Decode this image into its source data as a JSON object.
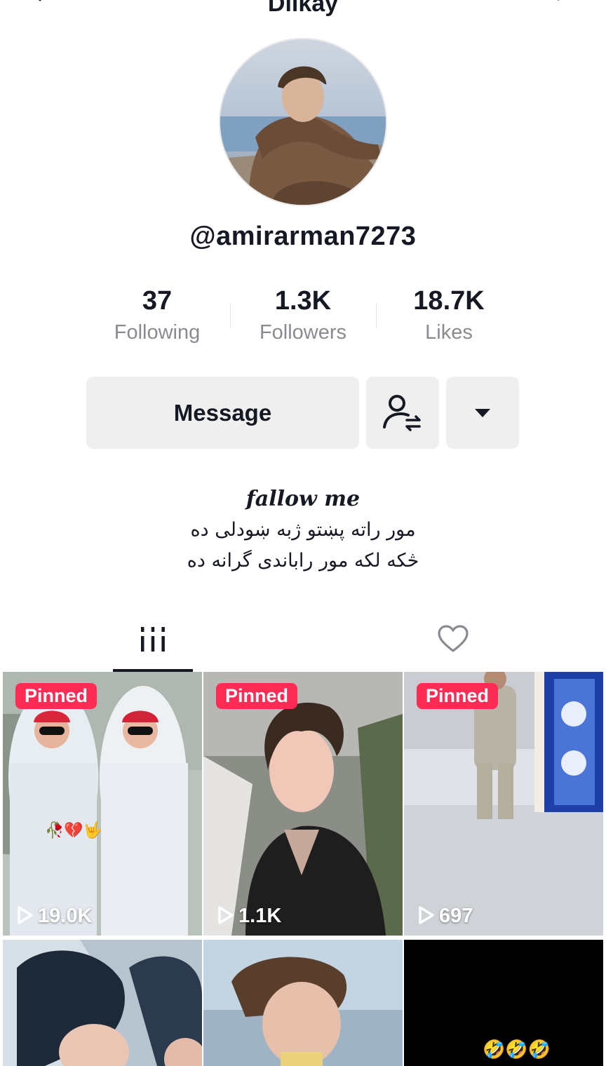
{
  "header": {
    "title": "Dilkay",
    "back_icon": "chevron-left-icon",
    "more_icon": "more-vertical-icon"
  },
  "profile": {
    "username": "@amirarman7273",
    "stats": [
      {
        "value": "37",
        "label": "Following"
      },
      {
        "value": "1.3K",
        "label": "Followers"
      },
      {
        "value": "18.7K",
        "label": "Likes"
      }
    ],
    "actions": {
      "message_label": "Message",
      "friends_icon": "user-swap-icon",
      "dropdown_icon": "caret-down-icon"
    },
    "bio": {
      "line1": "fallow me",
      "line2": "مور راته پښتو ژبه ښودلی ده",
      "line3": "څکه لکه مور راباندی گرانه ده"
    }
  },
  "tabs": [
    {
      "name": "videos",
      "icon": "grid-bars-icon",
      "active": true
    },
    {
      "name": "liked",
      "icon": "heart-outline-icon",
      "active": false
    }
  ],
  "videos": [
    {
      "pinned_label": "Pinned",
      "views": "19.0K",
      "overlay": "🥀💔🤟"
    },
    {
      "pinned_label": "Pinned",
      "views": "1.1K"
    },
    {
      "pinned_label": "Pinned",
      "views": "697"
    },
    {},
    {},
    {
      "overlay": "🤣🤣🤣"
    }
  ],
  "colors": {
    "accent": "#fe2c55",
    "text": "#161823",
    "muted": "#8a8b91",
    "button_bg": "#efefef"
  }
}
